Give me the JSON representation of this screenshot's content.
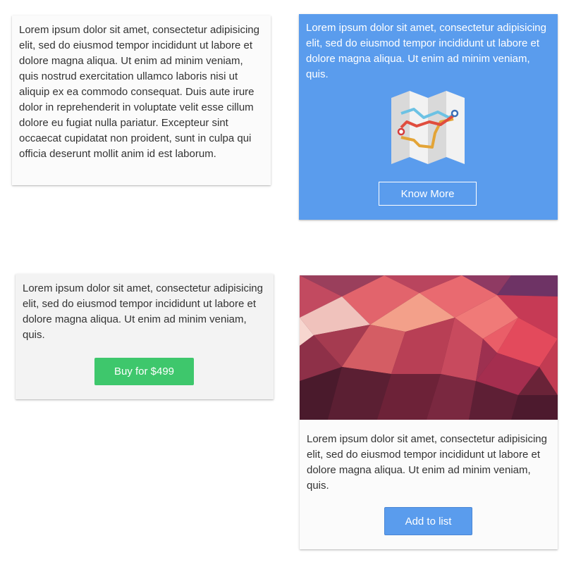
{
  "cards": [
    {
      "text": "Lorem ipsum dolor sit amet, consectetur adipisicing elit, sed do eiusmod tempor incididunt ut labore et dolore magna aliqua. Ut enim ad minim veniam, quis nostrud exercitation ullamco laboris nisi ut aliquip ex ea commodo consequat. Duis aute irure dolor in reprehenderit in voluptate velit esse cillum dolore eu fugiat nulla pariatur. Excepteur sint occaecat cupidatat non proident, sunt in culpa qui officia deserunt mollit anim id est laborum."
    },
    {
      "text": "Lorem ipsum dolor sit amet, consectetur adipisicing elit, sed do eiusmod tempor incididunt ut labore et dolore magna aliqua. Ut enim ad minim veniam, quis.",
      "icon": "folded-map-icon",
      "button_label": "Know More",
      "background": "#5a9ced"
    },
    {
      "text": "Lorem ipsum dolor sit amet, consectetur adipisicing elit, sed do eiusmod tempor incididunt ut labore et dolore magna aliqua. Ut enim ad minim veniam, quis.",
      "button_label": "Buy for $499",
      "button_color": "#3ec76c"
    },
    {
      "image": "low-poly-abstract-image",
      "text": "Lorem ipsum dolor sit amet, consectetur adipisicing elit, sed do eiusmod tempor incididunt ut labore et dolore magna aliqua. Ut enim ad minim veniam, quis.",
      "button_label": "Add to list",
      "button_color": "#5a9ced"
    }
  ]
}
